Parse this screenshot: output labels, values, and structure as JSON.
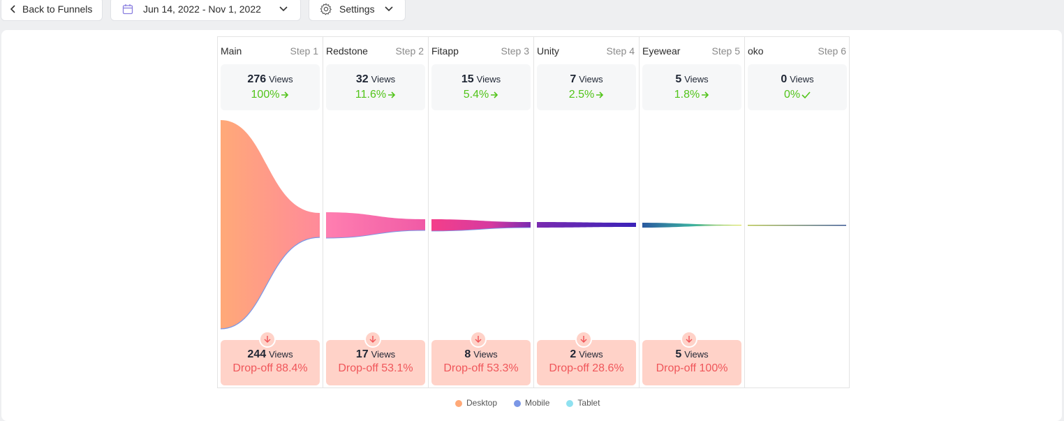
{
  "toolbar": {
    "back_label": "Back to Funnels",
    "date_range": "Jun 14, 2022 - Nov 1, 2022",
    "settings_label": "Settings"
  },
  "funnel": {
    "views_unit": "Views",
    "steps": [
      {
        "name": "Main",
        "step": "Step 1",
        "views": "276",
        "pct": "100%",
        "pct_icon": "arrow-right-icon",
        "drop_views": "244",
        "drop_pct": "Drop-off 88.4%"
      },
      {
        "name": "Redstone",
        "step": "Step 2",
        "views": "32",
        "pct": "11.6%",
        "pct_icon": "arrow-right-icon",
        "drop_views": "17",
        "drop_pct": "Drop-off 53.1%"
      },
      {
        "name": "Fitapp",
        "step": "Step 3",
        "views": "15",
        "pct": "5.4%",
        "pct_icon": "arrow-right-icon",
        "drop_views": "8",
        "drop_pct": "Drop-off 53.3%"
      },
      {
        "name": "Unity",
        "step": "Step 4",
        "views": "7",
        "pct": "2.5%",
        "pct_icon": "arrow-right-icon",
        "drop_views": "2",
        "drop_pct": "Drop-off 28.6%"
      },
      {
        "name": "Eyewear",
        "step": "Step 5",
        "views": "5",
        "pct": "1.8%",
        "pct_icon": "arrow-right-icon",
        "drop_views": "5",
        "drop_pct": "Drop-off 100%"
      },
      {
        "name": "oko",
        "step": "Step 6",
        "views": "0",
        "pct": "0%",
        "pct_icon": "check-icon"
      }
    ]
  },
  "colors": {
    "success": "#52c41a",
    "danger": "#f0565a",
    "drop_bg": "#ffd2c8",
    "legend_desktop": "#ffa978",
    "legend_mobile": "#7b97e6",
    "legend_tablet": "#8fe1f0"
  },
  "legend": [
    {
      "label": "Desktop"
    },
    {
      "label": "Mobile"
    },
    {
      "label": "Tablet"
    }
  ]
}
